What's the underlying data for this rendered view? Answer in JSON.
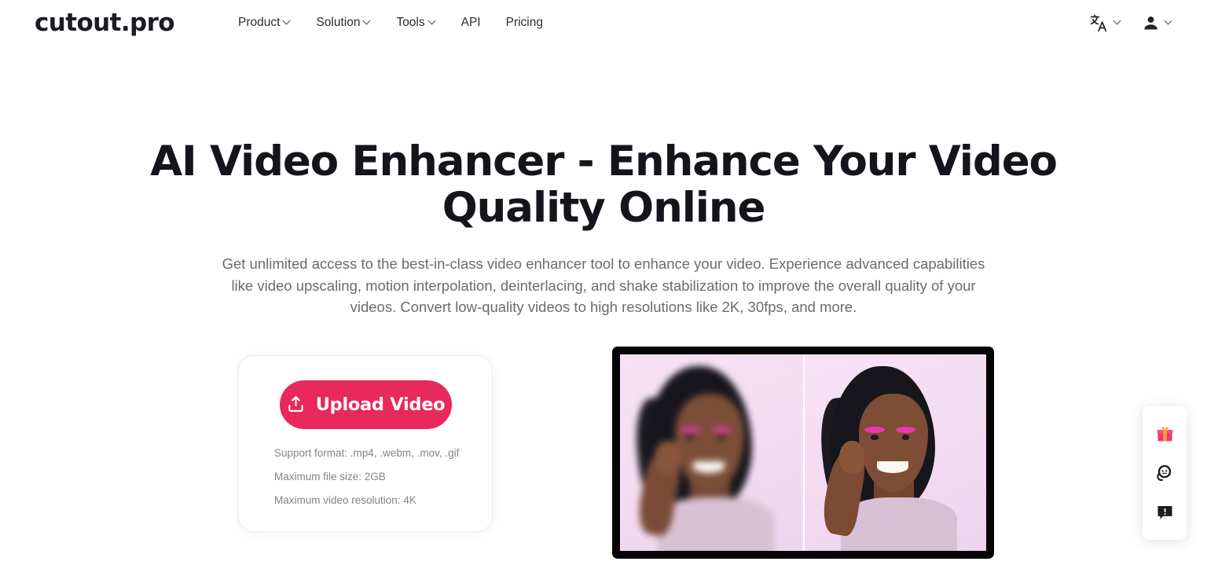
{
  "brand": {
    "logo_text": "cutout.pro",
    "accent_color": "#e9285b",
    "heading_color": "#14141a"
  },
  "header": {
    "nav_items": [
      {
        "label": "Product",
        "has_dropdown": true
      },
      {
        "label": "Solution",
        "has_dropdown": true
      },
      {
        "label": "Tools",
        "has_dropdown": true
      },
      {
        "label": "API",
        "has_dropdown": false
      },
      {
        "label": "Pricing",
        "has_dropdown": false
      }
    ],
    "controls": [
      {
        "icon": "language-translate-icon",
        "has_dropdown": true
      },
      {
        "icon": "user-account-icon",
        "has_dropdown": true
      }
    ]
  },
  "hero": {
    "title": "AI Video Enhancer - Enhance Your Video Quality Online",
    "subtitle": "Get unlimited access to the best-in-class video enhancer tool to enhance your video. Experience advanced capabilities like video upscaling, motion interpolation, deinterlacing, and shake stabilization to improve the overall quality of your videos. Convert low-quality videos to high resolutions like 2K, 30fps, and more."
  },
  "upload_card": {
    "button_label": "Upload Video",
    "button_icon": "upload-icon",
    "support_lines": [
      "Support format: .mp4, .webm, .mov, .gif",
      "Maximum file size: 2GB",
      "Maximum video resolution: 4K"
    ]
  },
  "preview": {
    "label": "before-after-video-comparison",
    "left_state": "low-quality blurry video frame",
    "right_state": "enhanced sharp video frame"
  },
  "float_widget": {
    "items": [
      {
        "icon": "gift-icon",
        "color": "#e9285b"
      },
      {
        "icon": "customer-service-face-icon",
        "color": "#1b1b21"
      },
      {
        "icon": "feedback-bubble-icon",
        "color": "#1b1b21"
      }
    ]
  }
}
